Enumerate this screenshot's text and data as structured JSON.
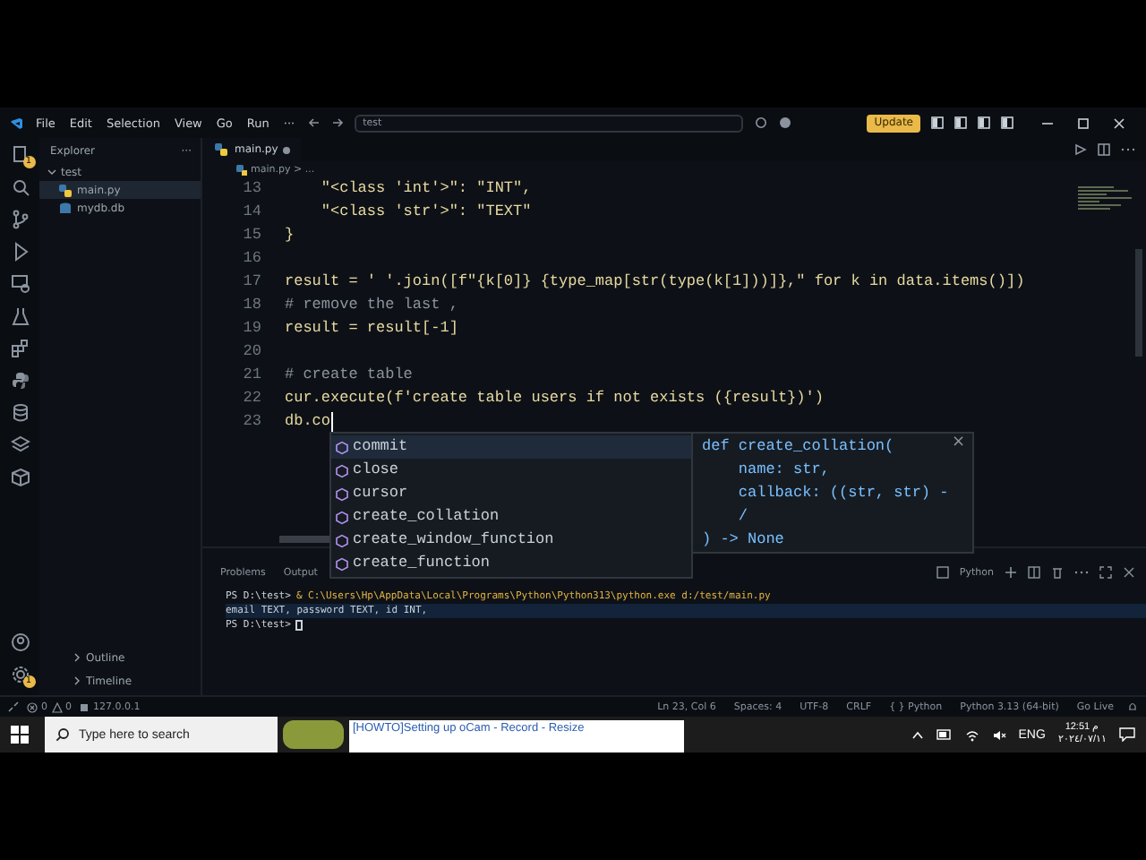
{
  "title_bar": {
    "menu": [
      "File",
      "Edit",
      "Selection",
      "View",
      "Go",
      "Run",
      "···"
    ],
    "search": {
      "value": "test"
    },
    "update_button": "Update"
  },
  "activity_bar": {
    "explorer_badge": "1",
    "settings_badge": "1"
  },
  "sidebar": {
    "title": "Explorer",
    "more": "···",
    "folder": {
      "label": "test",
      "expanded": true,
      "children": [
        {
          "label": "main.py",
          "kind": "python",
          "selected": true
        },
        {
          "label": "mydb.db",
          "kind": "database",
          "selected": false
        }
      ]
    },
    "sections": [
      {
        "label": "Outline",
        "expanded": false
      },
      {
        "label": "Timeline",
        "expanded": false
      }
    ]
  },
  "tabs": [
    {
      "label": "main.py",
      "selected": true,
      "modified": true
    }
  ],
  "breadcrumb": "main.py > ...",
  "editor": {
    "lines": [
      {
        "number": "13",
        "text": "    \"<class 'int'>\": \"INT\",",
        "kind": "code"
      },
      {
        "number": "14",
        "text": "    \"<class 'str'>\": \"TEXT\"",
        "kind": "code"
      },
      {
        "number": "15",
        "text": "}",
        "kind": "code"
      },
      {
        "number": "16"
      },
      {
        "number": "17",
        "text": "result = ' '.join([f\"{k[0]} {type_map[str(type(k[1]))]},\" for k in data.items()])",
        "kind": "code"
      },
      {
        "number": "18",
        "text": "# remove the last ,",
        "kind": "comment"
      },
      {
        "number": "19",
        "text": "result = result[-1]",
        "kind": "code"
      },
      {
        "number": "20"
      },
      {
        "number": "21",
        "text": "# create table",
        "kind": "comment"
      },
      {
        "number": "22",
        "text": "cur.execute(f'create table users if not exists ({result})')",
        "kind": "code"
      },
      {
        "number": "23",
        "text": "db.co",
        "kind": "code"
      }
    ]
  },
  "suggestions": [
    {
      "label": "commit",
      "selected": true
    },
    {
      "label": "close",
      "selected": false
    },
    {
      "label": "cursor",
      "selected": false
    },
    {
      "label": "create_collation",
      "selected": false
    },
    {
      "label": "create_window_function",
      "selected": false
    },
    {
      "label": "create_function",
      "selected": false
    }
  ],
  "hover_doc": {
    "lines": [
      "def create_collation(",
      "    name: str,",
      "    callback: ((str, str) -",
      "    /",
      ") -> None"
    ],
    "close": "×"
  },
  "panel": {
    "tabs": [
      {
        "label": "Problems",
        "selected": false
      },
      {
        "label": "Output",
        "selected": false
      }
    ],
    "terminal_name": "Python",
    "terminal": [
      {
        "prompt": "PS D:\\test>",
        "command": "& C:\\Users\\Hp\\AppData\\Local\\Programs\\Python\\Python313\\python.exe d:/test/main.py"
      },
      {
        "output": "email TEXT, password TEXT, id INT,"
      },
      {
        "prompt": "PS D:\\test>"
      }
    ]
  },
  "status_bar": {
    "errors": "0",
    "warnings": "0",
    "port": "127.0.0.1",
    "right": [
      "Ln 23, Col 6",
      "Spaces: 4",
      "UTF-8",
      "CRLF",
      "{ } Python",
      "Python 3.13 (64-bit)",
      "Go Live"
    ]
  },
  "taskbar": {
    "search": {
      "placeholder": "Type here to search"
    },
    "window_title": "[HOWTO]Setting up oCam - Record - Resize",
    "language": "ENG",
    "time": "12:51 م",
    "date": "٢٠٢٤/٠٧/١١"
  }
}
